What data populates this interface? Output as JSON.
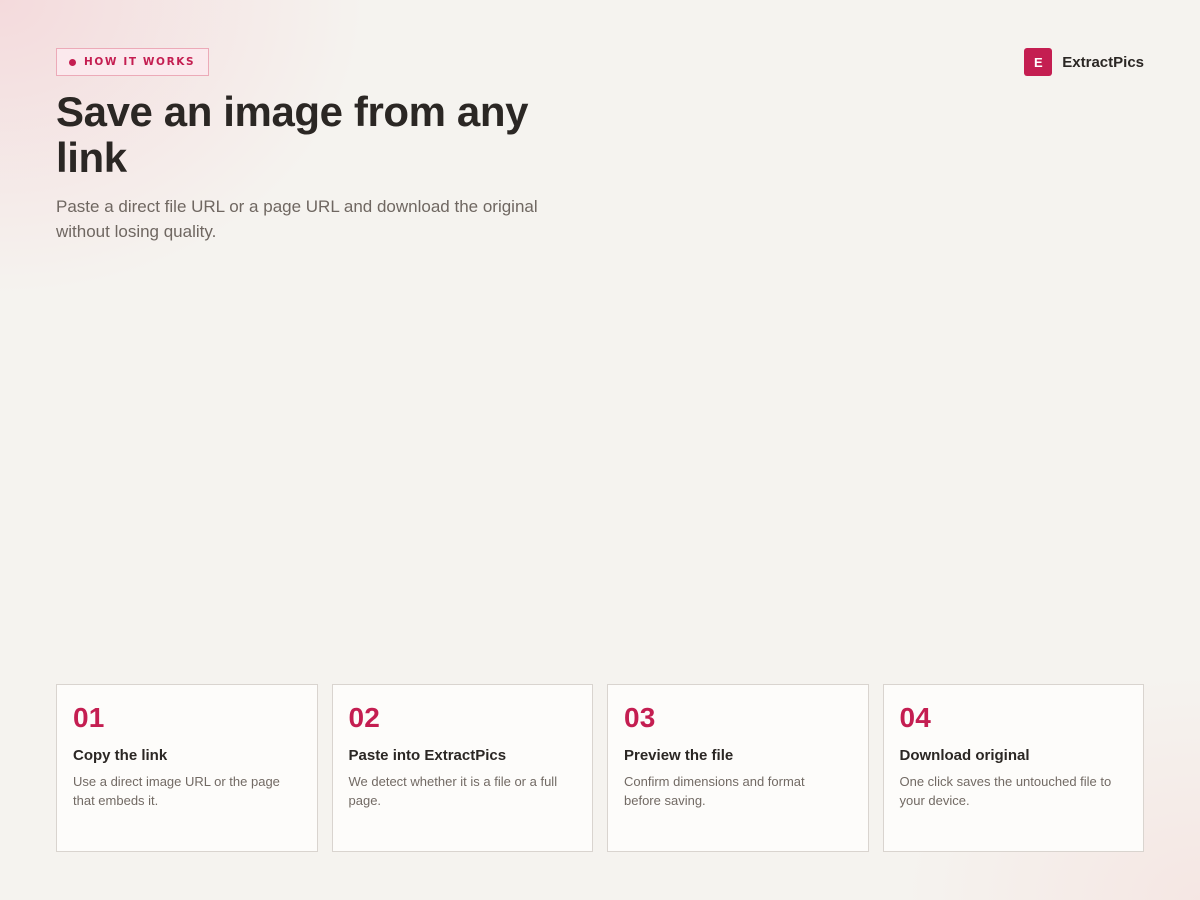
{
  "badge": {
    "label": "HOW IT WORKS"
  },
  "brand": {
    "logo_letter": "E",
    "name": "ExtractPics"
  },
  "hero": {
    "title": "Save an image from any link",
    "subtitle": "Paste a direct file URL or a page URL and download the original without losing quality."
  },
  "steps": [
    {
      "number": "01",
      "title": "Copy the link",
      "description": "Use a direct image URL or the page that embeds it."
    },
    {
      "number": "02",
      "title": "Paste into ExtractPics",
      "description": "We detect whether it is a file or a full page."
    },
    {
      "number": "03",
      "title": "Preview the file",
      "description": "Confirm dimensions and format before saving."
    },
    {
      "number": "04",
      "title": "Download original",
      "description": "One click saves the untouched file to your device."
    }
  ],
  "colors": {
    "accent": "#c41e51",
    "background": "#f5f3ef",
    "text": "#2b2724"
  }
}
